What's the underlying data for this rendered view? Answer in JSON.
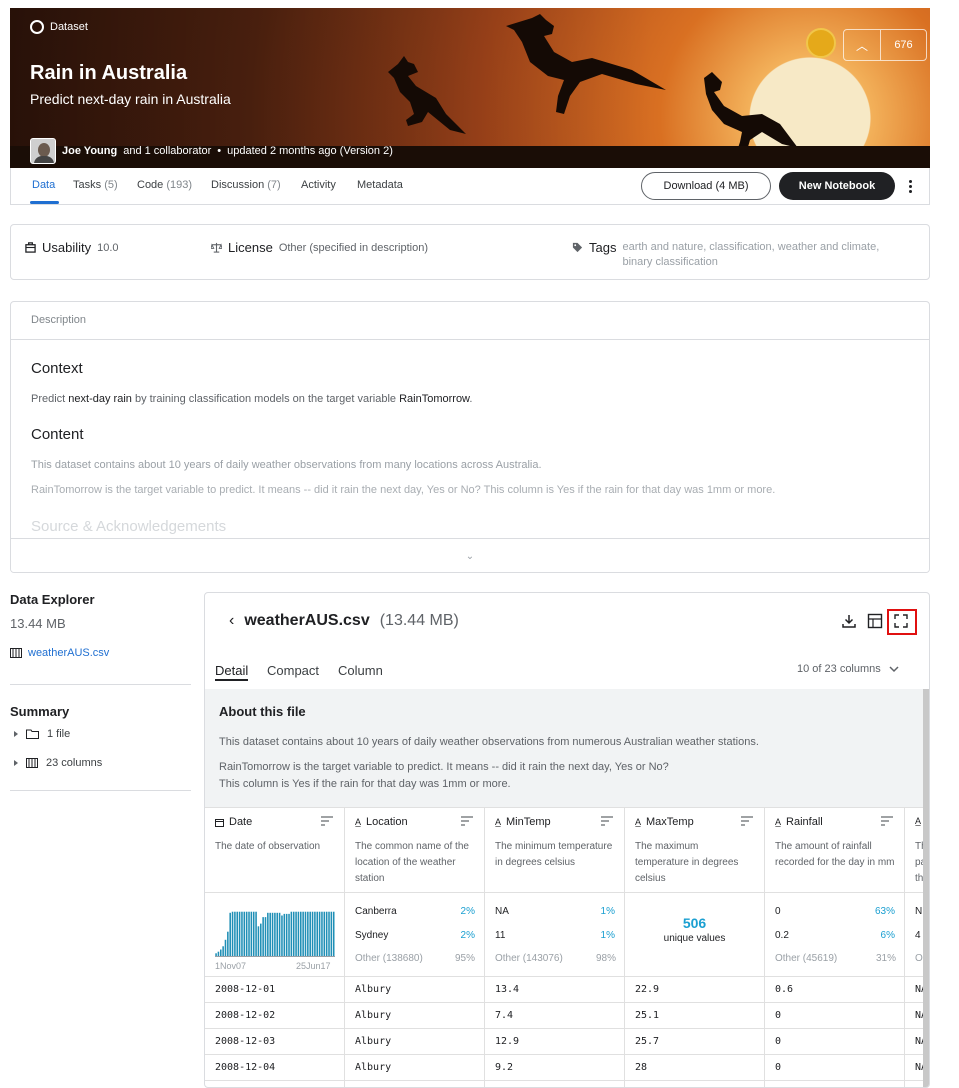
{
  "banner": {
    "type_label": "Dataset",
    "title": "Rain in Australia",
    "subtitle": "Predict next-day rain in Australia",
    "author": "Joe Young",
    "collaborators": "and 1 collaborator",
    "separator": "•",
    "updated": "updated 2 months ago (Version 2)",
    "upvote_count": "676"
  },
  "tabs": [
    {
      "label": "Data",
      "count": ""
    },
    {
      "label": "Tasks",
      "count": "(5)"
    },
    {
      "label": "Code",
      "count": "(193)"
    },
    {
      "label": "Discussion",
      "count": "(7)"
    },
    {
      "label": "Activity",
      "count": ""
    },
    {
      "label": "Metadata",
      "count": ""
    }
  ],
  "actions": {
    "download": "Download (4 MB)",
    "new_notebook": "New Notebook"
  },
  "meta": {
    "usability_label": "Usability",
    "usability_value": "10.0",
    "license_label": "License",
    "license_value": "Other (specified in description)",
    "tags_label": "Tags",
    "tags_value": "earth and nature, classification, weather and climate, binary classification"
  },
  "description": {
    "header": "Description",
    "context_h": "Context",
    "context_p1": "Predict ",
    "context_b1": "next-day rain",
    "context_p2": " by training classification models on the target variable ",
    "context_b2": "RainTomorrow",
    "context_p3": ".",
    "content_h": "Content",
    "content_p1": "This dataset contains about 10 years of daily weather observations from many locations across Australia.",
    "content_p2": "RainTomorrow is the target variable to predict. It means -- did it rain the next day, Yes or No? This column is Yes if the rain for that day was 1mm or more.",
    "source_h": "Source & Acknowledgements",
    "expand": "⌄"
  },
  "explorer": {
    "title": "Data Explorer",
    "size": "13.44 MB",
    "file": "weatherAUS.csv"
  },
  "summary": {
    "title": "Summary",
    "items": [
      "1 file",
      "23 columns"
    ]
  },
  "file": {
    "name": "weatherAUS.csv",
    "size": "(13.44 MB)",
    "tabs": [
      "Detail",
      "Compact",
      "Column"
    ],
    "col_count": "10 of 23 columns",
    "about_title": "About this file",
    "about_p1": "This dataset contains about 10 years of daily weather observations from numerous Australian weather stations.",
    "about_p2a": "RainTomorrow is the target variable to predict. It means -- did it rain the next day, Yes or No?",
    "about_p2b": "This column is Yes if the rain for that day was 1mm or more."
  },
  "columns": [
    {
      "name": "Date",
      "desc": "The date of observation"
    },
    {
      "name": "Location",
      "desc": "The common name of the location of the weather station"
    },
    {
      "name": "MinTemp",
      "desc": "The minimum temperature in degrees celsius"
    },
    {
      "name": "MaxTemp",
      "desc": "The maximum temperature in degrees celsius"
    },
    {
      "name": "Rainfall",
      "desc": "The amount of rainfall recorded for the day in mm"
    }
  ],
  "stats": {
    "date_start": "1Nov07",
    "date_end": "25Jun17",
    "location": {
      "v1": "Canberra",
      "p1": "2%",
      "v2": "Sydney",
      "p2": "2%",
      "other": "Other (138680)",
      "op": "95%"
    },
    "mintemp": {
      "v1": "NA",
      "p1": "1%",
      "v2": "11",
      "p2": "1%",
      "other": "Other (143076)",
      "op": "98%"
    },
    "maxtemp": {
      "unique": "506",
      "unique_label": "unique values"
    },
    "rainfall": {
      "v1": "0",
      "p1": "63%",
      "v2": "0.2",
      "p2": "6%",
      "other": "Other (45619)",
      "op": "31%"
    }
  },
  "chart_data": {
    "type": "bar",
    "title": "",
    "xlabel": "",
    "ylabel": "",
    "categories": [
      "1Nov07",
      "25Jun17"
    ],
    "values": [
      0.05,
      0.08,
      0.12,
      0.18,
      0.3,
      0.45,
      0.8,
      0.82,
      0.82,
      0.82,
      0.82,
      0.82,
      0.82,
      0.82,
      0.82,
      0.82,
      0.82,
      0.82,
      0.55,
      0.6,
      0.72,
      0.72,
      0.8,
      0.8,
      0.8,
      0.8,
      0.8,
      0.8,
      0.75,
      0.78,
      0.78,
      0.78,
      0.82,
      0.82,
      0.82,
      0.82,
      0.82,
      0.82,
      0.82,
      0.82,
      0.82,
      0.82,
      0.82,
      0.82,
      0.82,
      0.82,
      0.82,
      0.82,
      0.82,
      0.82,
      0.82
    ],
    "ylim": [
      0,
      1
    ]
  },
  "rows": [
    {
      "date": "2008-12-01",
      "location": "Albury",
      "min": "13.4",
      "max": "22.9",
      "rain": "0.6",
      "extra": "NA"
    },
    {
      "date": "2008-12-02",
      "location": "Albury",
      "min": "7.4",
      "max": "25.1",
      "rain": "0",
      "extra": "NA"
    },
    {
      "date": "2008-12-03",
      "location": "Albury",
      "min": "12.9",
      "max": "25.7",
      "rain": "0",
      "extra": "NA"
    },
    {
      "date": "2008-12-04",
      "location": "Albury",
      "min": "9.2",
      "max": "28",
      "rain": "0",
      "extra": "NA"
    }
  ],
  "partial_col": {
    "stat1": "N",
    "stat2": "4",
    "stat_other": "O",
    "desc1": "Th",
    "desc2": "pa",
    "desc3": "th"
  }
}
